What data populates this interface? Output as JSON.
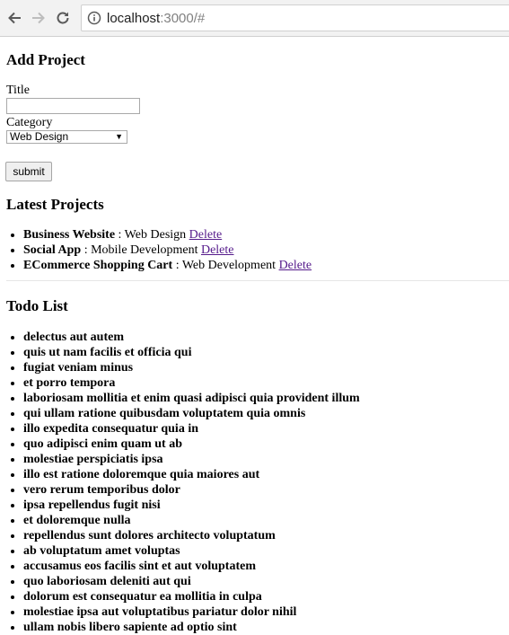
{
  "browser": {
    "url_host": "localhost",
    "url_rest": ":3000/#"
  },
  "add_project": {
    "heading": "Add Project",
    "title_label": "Title",
    "title_value": "",
    "category_label": "Category",
    "category_selected": "Web Design",
    "submit_label": "submit"
  },
  "latest": {
    "heading": "Latest Projects",
    "items": [
      {
        "title": "Business Website",
        "category": " : Web Design ",
        "action": "Delete"
      },
      {
        "title": "Social App",
        "category": " : Mobile Development ",
        "action": "Delete"
      },
      {
        "title": "ECommerce Shopping Cart",
        "category": " : Web Development ",
        "action": "Delete"
      }
    ]
  },
  "todo": {
    "heading": "Todo List",
    "items": [
      "delectus aut autem",
      "quis ut nam facilis et officia qui",
      "fugiat veniam minus",
      "et porro tempora",
      "laboriosam mollitia et enim quasi adipisci quia provident illum",
      "qui ullam ratione quibusdam voluptatem quia omnis",
      "illo expedita consequatur quia in",
      "quo adipisci enim quam ut ab",
      "molestiae perspiciatis ipsa",
      "illo est ratione doloremque quia maiores aut",
      "vero rerum temporibus dolor",
      "ipsa repellendus fugit nisi",
      "et doloremque nulla",
      "repellendus sunt dolores architecto voluptatum",
      "ab voluptatum amet voluptas",
      "accusamus eos facilis sint et aut voluptatem",
      "quo laboriosam deleniti aut qui",
      "dolorum est consequatur ea mollitia in culpa",
      "molestiae ipsa aut voluptatibus pariatur dolor nihil",
      "ullam nobis libero sapiente ad optio sint"
    ]
  }
}
